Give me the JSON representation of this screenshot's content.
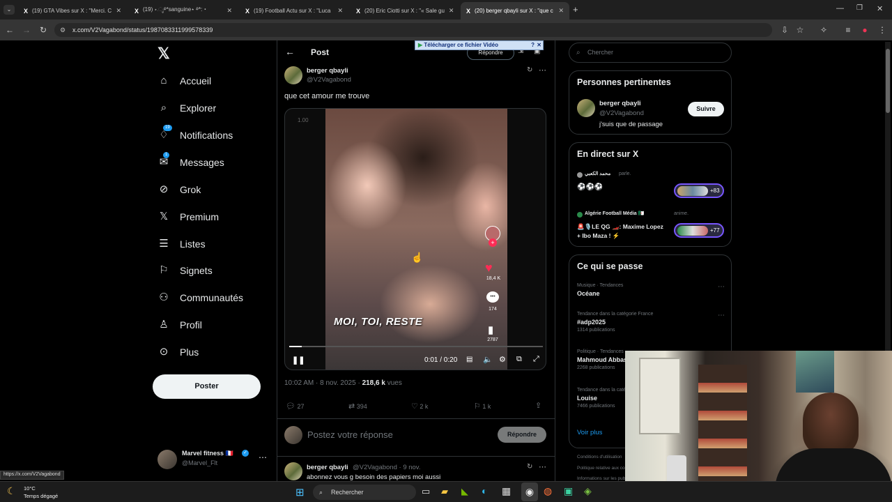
{
  "browser": {
    "tabs": [
      {
        "label": "(19) GTA Vibes sur X : \"Merci. C",
        "active": false
      },
      {
        "label": "(19) ⋆.ೃ࿔*sanguine⋆ ࿔*:・",
        "active": false
      },
      {
        "label": "(19) Football Actu sur X : \"Luca",
        "active": false
      },
      {
        "label": "(20) Eric Ciotti sur X : \"« Sale gu",
        "active": false
      },
      {
        "label": "(20) berger qbayli sur X : \"que c",
        "active": true
      }
    ],
    "url": "x.com/V2Vagabond/status/1987083311999578339",
    "download_banner": "Télécharger ce fichier Vidéo",
    "status_url": "https://x.com/V2Vagabond"
  },
  "nav": {
    "items": [
      {
        "label": "Accueil",
        "icon": "home-icon",
        "glyph": "⌂"
      },
      {
        "label": "Explorer",
        "icon": "search-icon",
        "glyph": "⌕"
      },
      {
        "label": "Notifications",
        "icon": "bell-icon",
        "glyph": "♢",
        "badge": "19"
      },
      {
        "label": "Messages",
        "icon": "mail-icon",
        "glyph": "✉",
        "badge": "1"
      },
      {
        "label": "Grok",
        "icon": "grok-icon",
        "glyph": "⊘"
      },
      {
        "label": "Premium",
        "icon": "x-logo-icon",
        "glyph": "𝕏"
      },
      {
        "label": "Listes",
        "icon": "list-icon",
        "glyph": "☰"
      },
      {
        "label": "Signets",
        "icon": "bookmark-icon",
        "glyph": "⚐"
      },
      {
        "label": "Communautés",
        "icon": "community-icon",
        "glyph": "⚇"
      },
      {
        "label": "Profil",
        "icon": "profile-icon",
        "glyph": "♙"
      },
      {
        "label": "Plus",
        "icon": "more-circle-icon",
        "glyph": "⊙"
      }
    ],
    "post_button": "Poster",
    "account": {
      "name": "Marvel fitness 🇫🇷",
      "handle": "@Marvel_Flt"
    }
  },
  "post": {
    "header_title": "Post",
    "reply_top": "Répondre",
    "author_name": "berger qbayli",
    "author_handle": "@V2Vagabond",
    "text": "que cet amour me trouve",
    "video": {
      "speed": "1.00",
      "caption": "MOI, TOI, RESTE",
      "time": "0:01 / 0:20",
      "likes": "18,4 K",
      "comments": "174",
      "saves": "2787",
      "progress": 0.05
    },
    "timestamp": "10:02 AM · 8 nov. 2025 ·",
    "views_number": "218,6 k",
    "views_label": "vues",
    "stats": {
      "replies": "27",
      "reposts": "394",
      "likes": "2 k",
      "bookmarks": "1 k"
    },
    "reply_placeholder": "Postez votre réponse",
    "reply_button": "Répondre",
    "next_reply": {
      "name": "berger qbayli",
      "handle": "@V2Vagabond · 9 nov.",
      "text": "abonnez vous g besoin des papiers moi aussi"
    }
  },
  "right": {
    "search_placeholder": "Chercher",
    "relevant": {
      "title": "Personnes pertinentes",
      "name": "berger qbayli",
      "handle": "@V2Vagabond",
      "bio": "j'suis que de passage",
      "follow": "Suivre"
    },
    "live": {
      "title": "En direct sur X",
      "items": [
        {
          "host": "محمد الكعبي",
          "action": "parle.",
          "text": "⚽⚽⚽",
          "count": "+83"
        },
        {
          "host": "Algérie Football Média 🇩🇿",
          "action": "anime.",
          "text": "🚨🎙️LE QG 🏎️: Maxime Lopez + Ibo Maza ! ⚡",
          "count": "+77"
        }
      ]
    },
    "trends": {
      "title": "Ce qui se passe",
      "items": [
        {
          "meta": "Musique · Tendances",
          "name": "Océane",
          "count": ""
        },
        {
          "meta": "Tendance dans la catégorie France",
          "name": "#adp2025",
          "count": "1314 publications"
        },
        {
          "meta": "Politique · Tendances",
          "name": "Mahmoud Abbas",
          "count": "2268 publications"
        },
        {
          "meta": "Tendance dans la catégorie France",
          "name": "Louise",
          "count": "7466 publications"
        }
      ],
      "show_more": "Voir plus"
    },
    "footer1": "Conditions d'utilisation",
    "footer2": "Politique relative aux cookies",
    "footer3": "Informations sur les publicités"
  },
  "taskbar": {
    "weather_temp": "10°C",
    "weather_desc": "Temps dégagé",
    "search": "Rechercher"
  }
}
